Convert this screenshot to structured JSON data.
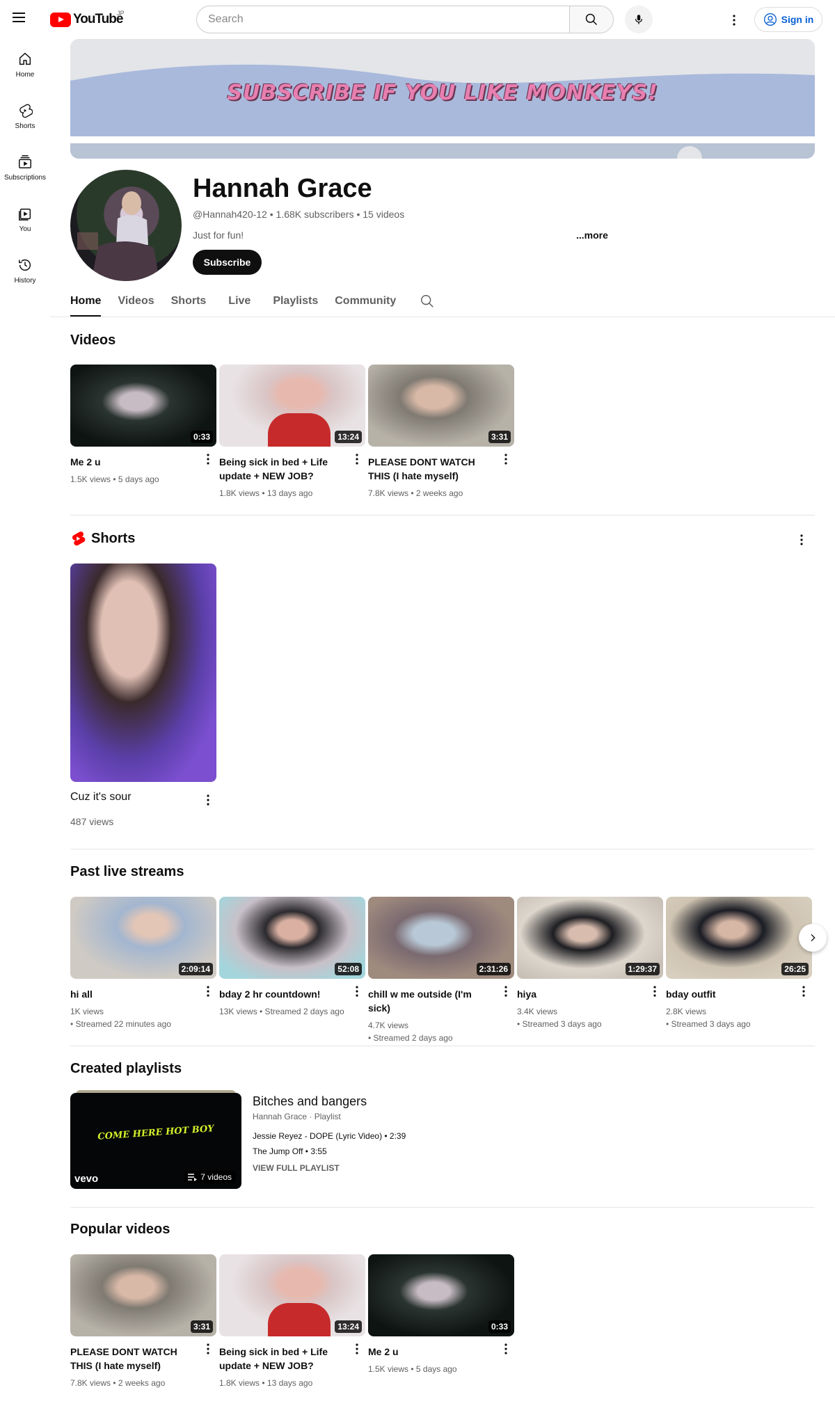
{
  "header": {
    "logo_text": "YouTube",
    "region": "JP",
    "search_placeholder": "Search",
    "sign_in": "Sign in"
  },
  "sidebar": {
    "items": [
      {
        "label": "Home",
        "icon": "home-icon"
      },
      {
        "label": "Shorts",
        "icon": "shorts-icon"
      },
      {
        "label": "Subscriptions",
        "icon": "subscriptions-icon"
      },
      {
        "label": "You",
        "icon": "you-icon"
      },
      {
        "label": "History",
        "icon": "history-icon"
      }
    ]
  },
  "banner": {
    "text": "SUBSCRIBE IF YOU LIKE MONKEYS!"
  },
  "channel": {
    "name": "Hannah Grace",
    "meta": "@Hannah420-12 • 1.68K subscribers • 15 videos",
    "description": "Just for fun!",
    "more": "...more",
    "subscribe": "Subscribe"
  },
  "tabs": [
    "Home",
    "Videos",
    "Shorts",
    "Live",
    "Playlists",
    "Community"
  ],
  "videos": {
    "title": "Videos",
    "items": [
      {
        "title": "Me 2 u",
        "duration": "0:33",
        "meta": "1.5K views • 5 days ago"
      },
      {
        "title": "Being sick in bed + Life update + NEW JOB?",
        "duration": "13:24",
        "meta": "1.8K views • 13 days ago"
      },
      {
        "title": "PLEASE DONT WATCH THIS (I hate myself)",
        "duration": "3:31",
        "meta": "7.8K views • 2 weeks ago"
      }
    ]
  },
  "shorts": {
    "title": "Shorts",
    "items": [
      {
        "title": "Cuz it's sour",
        "meta": "487 views"
      }
    ]
  },
  "live": {
    "title": "Past live streams",
    "items": [
      {
        "title": "hi all",
        "duration": "2:09:14",
        "meta1": "1K views",
        "meta2": "• Streamed 22 minutes ago"
      },
      {
        "title": "bday 2 hr countdown!",
        "duration": "52:08",
        "meta1": "13K views • Streamed 2 days ago",
        "meta2": ""
      },
      {
        "title": "chill w me outside (I'm sick)",
        "duration": "2:31:26",
        "meta1": "4.7K views",
        "meta2": "• Streamed 2 days ago"
      },
      {
        "title": "hiya",
        "duration": "1:29:37",
        "meta1": "3.4K views",
        "meta2": "• Streamed 3 days ago"
      },
      {
        "title": "bday outfit",
        "duration": "26:25",
        "meta1": "2.8K views",
        "meta2": "• Streamed 3 days ago"
      }
    ]
  },
  "playlists": {
    "title": "Created playlists",
    "thumb_text": "COME HERE HOT BOY",
    "thumb_brand": "vevo",
    "count": "7 videos",
    "name": "Bitches and bangers",
    "sub": "Hannah Grace · Playlist",
    "tracks": [
      "Jessie Reyez - DOPE (Lyric Video) • 2:39",
      "The Jump Off • 3:55"
    ],
    "view_full": "VIEW FULL PLAYLIST"
  },
  "popular": {
    "title": "Popular videos",
    "items": [
      {
        "title": "PLEASE DONT WATCH THIS (I hate myself)",
        "duration": "3:31",
        "meta": "7.8K views • 2 weeks ago"
      },
      {
        "title": "Being sick in bed + Life update + NEW JOB?",
        "duration": "13:24",
        "meta": "1.8K views • 13 days ago"
      },
      {
        "title": "Me 2 u",
        "duration": "0:33",
        "meta": "1.5K views • 5 days ago"
      }
    ]
  }
}
